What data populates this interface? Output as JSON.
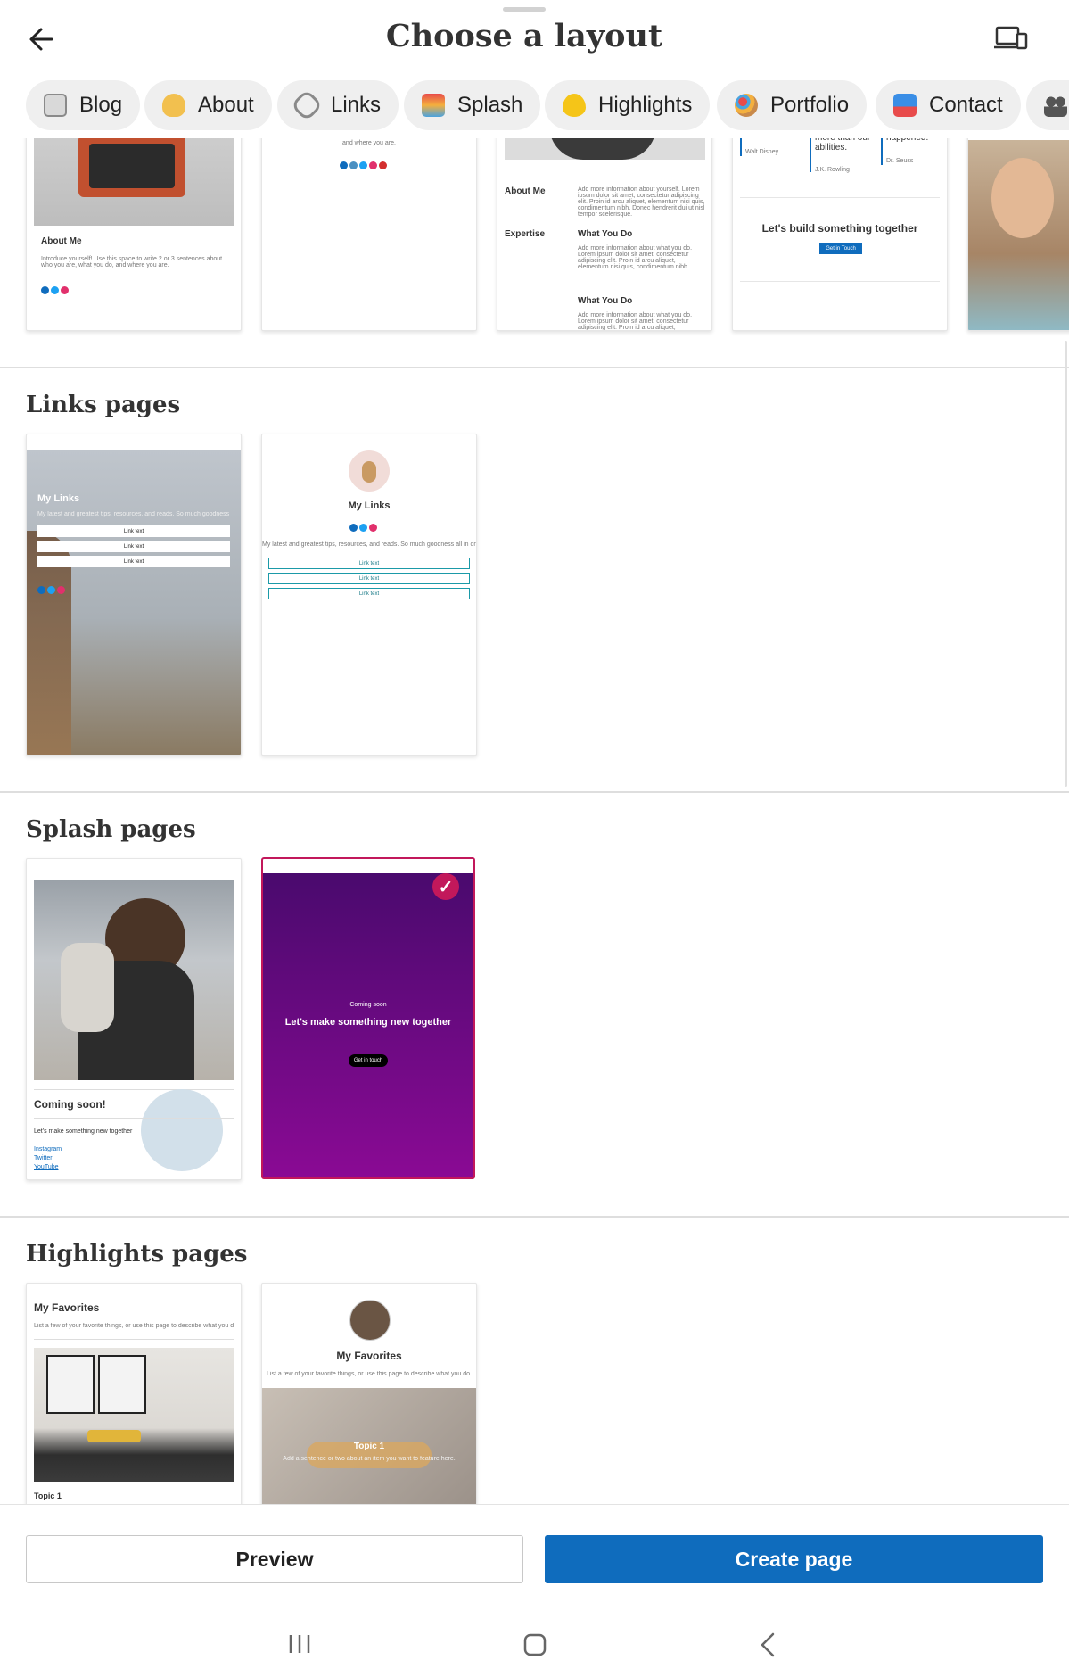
{
  "header": {
    "title": "Choose a layout",
    "back_icon": "arrow-left-icon",
    "device_icon": "device-preview-icon"
  },
  "chips": [
    {
      "label": "Blog",
      "icon": "newspaper-icon"
    },
    {
      "label": "About",
      "icon": "waving-hand-icon"
    },
    {
      "label": "Links",
      "icon": "link-icon"
    },
    {
      "label": "Splash",
      "icon": "splash-icon"
    },
    {
      "label": "Highlights",
      "icon": "heart-icon"
    },
    {
      "label": "Portfolio",
      "icon": "palette-icon"
    },
    {
      "label": "Contact",
      "icon": "mailbox-icon"
    },
    {
      "label": "",
      "icon": "people-icon"
    }
  ],
  "about_cards": {
    "card1": {
      "heading": "About Me",
      "text": "Introduce yourself! Use this space to write 2 or 3 sentences about who you are, what you do, and where you are."
    },
    "card2": {
      "text": "and where you are."
    },
    "card3": {
      "about": "About Me",
      "expertise": "Expertise",
      "what1": "What You Do",
      "what2": "What You Do",
      "body": "Add more information about yourself. Lorem ipsum dolor sit amet, consectetur adipiscing elit. Proin id arcu aliquet, elementum nisi quis, condimentum nibh. Donec hendrerit dui ut nisl tempor scelerisque.",
      "body2": "Add more information about what you do. Lorem ipsum dolor sit amet, consectetur adipiscing elit. Proin id arcu aliquet, elementum nisi quis, condimentum nibh."
    },
    "card4": {
      "quote1": "more than our abilities.",
      "author1": "J.K. Rowling",
      "quote2": "happened.",
      "author2": "Dr. Seuss",
      "author0": "Walt Disney",
      "cta": "Let's build something together",
      "button": "Get in Touch"
    }
  },
  "links": {
    "title": "Links pages",
    "card1": {
      "heading": "My Links",
      "sub": "My latest and greatest tips, resources, and reads. So much goodness all in one place!",
      "links": [
        "Link text",
        "Link text",
        "Link text"
      ]
    },
    "card2": {
      "heading": "My Links",
      "sub": "My latest and greatest tips, resources, and reads. So much goodness all in one place!",
      "links": [
        "Link text",
        "Link text",
        "Link text"
      ]
    }
  },
  "splash": {
    "title": "Splash pages",
    "card1": {
      "heading": "Coming soon!",
      "sub": "Let's make something new together",
      "links": [
        "Instagram",
        "Twitter",
        "YouTube"
      ]
    },
    "card2": {
      "kicker": "Coming soon",
      "heading": "Let's make something new together",
      "button": "Get in touch",
      "selected": true
    }
  },
  "highlights": {
    "title": "Highlights pages",
    "card1": {
      "heading": "My Favorites",
      "sub": "List a few of your favorite things, or use this page to describe what you do.",
      "topic": "Topic 1"
    },
    "card2": {
      "heading": "My Favorites",
      "sub": "List a few of your favorite things, or use this page to describe what you do.",
      "topic": "Topic 1",
      "topic_sub": "Add a sentence or two about an item you want to feature here."
    }
  },
  "footer": {
    "preview": "Preview",
    "create": "Create page"
  },
  "colors": {
    "accent": "#0f6cbd",
    "selected": "#c2185b",
    "purple_top": "#4a0a6e",
    "purple_bottom": "#8a0a94"
  }
}
